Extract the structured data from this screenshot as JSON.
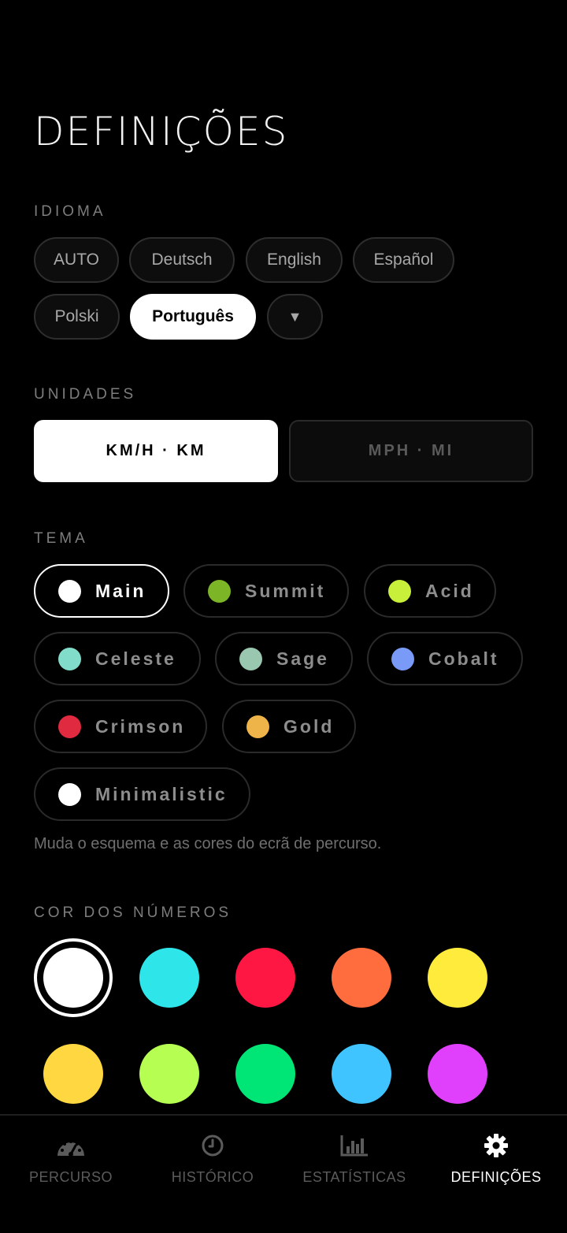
{
  "page": {
    "title": "DEFINIÇÕES"
  },
  "language": {
    "label": "IDIOMA",
    "options": [
      "AUTO",
      "Deutsch",
      "English",
      "Español",
      "Polski",
      "Português"
    ],
    "selected": "Português",
    "more_icon": "▼"
  },
  "units": {
    "label": "UNIDADES",
    "options": [
      "KM/H · KM",
      "MPH · MI"
    ],
    "selected": "KM/H · KM"
  },
  "theme": {
    "label": "TEMA",
    "selected": "Main",
    "options": [
      {
        "name": "Main",
        "color": "#ffffff"
      },
      {
        "name": "Summit",
        "color": "#7cb526"
      },
      {
        "name": "Acid",
        "color": "#c8ef3a"
      },
      {
        "name": "Celeste",
        "color": "#82dcca"
      },
      {
        "name": "Sage",
        "color": "#9ac7b0"
      },
      {
        "name": "Cobalt",
        "color": "#7a9af8"
      },
      {
        "name": "Crimson",
        "color": "#e02a3f"
      },
      {
        "name": "Gold",
        "color": "#eeb349"
      },
      {
        "name": "Minimalistic",
        "color": "#ffffff"
      }
    ],
    "hint": "Muda o esquema e as cores do ecrã de percurso."
  },
  "number_color": {
    "label": "COR DOS NÚMEROS",
    "selected": "#ffffff",
    "colors": [
      "#ffffff",
      "#2ee6ea",
      "#ff1744",
      "#ff6d3f",
      "#ffeb3b",
      "#ffd740",
      "#b6ff52",
      "#00e676",
      "#40c4ff",
      "#e040fb"
    ]
  },
  "tabs": [
    {
      "label": "PERCURSO",
      "icon": "speedometer-icon"
    },
    {
      "label": "HISTÓRICO",
      "icon": "clock-icon"
    },
    {
      "label": "ESTATÍSTICAS",
      "icon": "bar-chart-icon"
    },
    {
      "label": "DEFINIÇÕES",
      "icon": "gear-icon"
    }
  ],
  "active_tab": "DEFINIÇÕES"
}
